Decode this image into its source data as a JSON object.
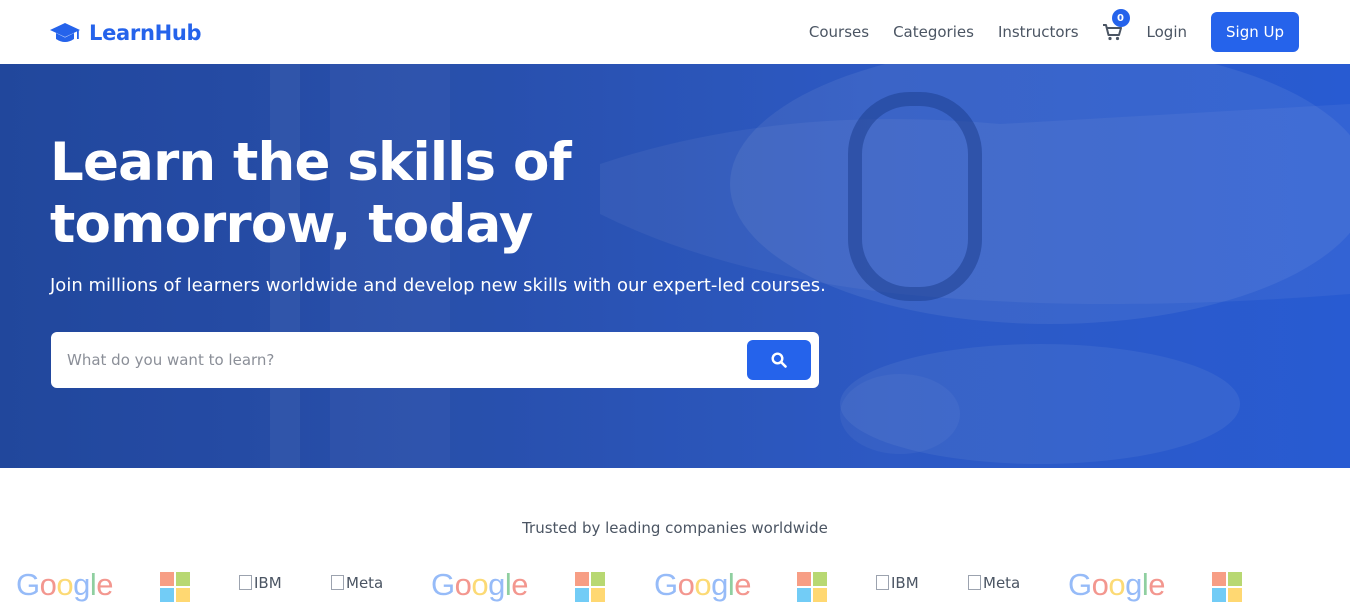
{
  "brand": {
    "name": "LearnHub",
    "icon": "graduation-cap-icon",
    "color": "#2563eb"
  },
  "nav": {
    "links": [
      "Courses",
      "Categories",
      "Instructors"
    ],
    "cart_count": "0",
    "cart_icon": "shopping-cart-icon",
    "login": "Login",
    "signup": "Sign Up"
  },
  "hero": {
    "title_line1": "Learn the skills of",
    "title_line2": "tomorrow, today",
    "subtitle": "Join millions of learners worldwide and develop new skills with our expert-led courses.",
    "search_placeholder": "What do you want to learn?",
    "search_icon": "search-icon"
  },
  "trusted": {
    "heading": "Trusted by leading companies worldwide",
    "logos": [
      {
        "name": "Google",
        "kind": "google"
      },
      {
        "name": "Microsoft",
        "kind": "microsoft"
      },
      {
        "name": "IBM",
        "kind": "broken"
      },
      {
        "name": "Meta",
        "kind": "broken"
      },
      {
        "name": "Google",
        "kind": "google"
      },
      {
        "name": "Microsoft",
        "kind": "microsoft"
      },
      {
        "name": "Google",
        "kind": "google"
      },
      {
        "name": "Microsoft",
        "kind": "microsoft"
      },
      {
        "name": "IBM",
        "kind": "broken"
      },
      {
        "name": "Meta",
        "kind": "broken"
      },
      {
        "name": "Google",
        "kind": "google"
      },
      {
        "name": "Microsoft",
        "kind": "microsoft"
      }
    ]
  },
  "colors": {
    "accent": "#2563eb",
    "hero_dark": "#22489e",
    "hero_light": "#2a5fdb"
  }
}
